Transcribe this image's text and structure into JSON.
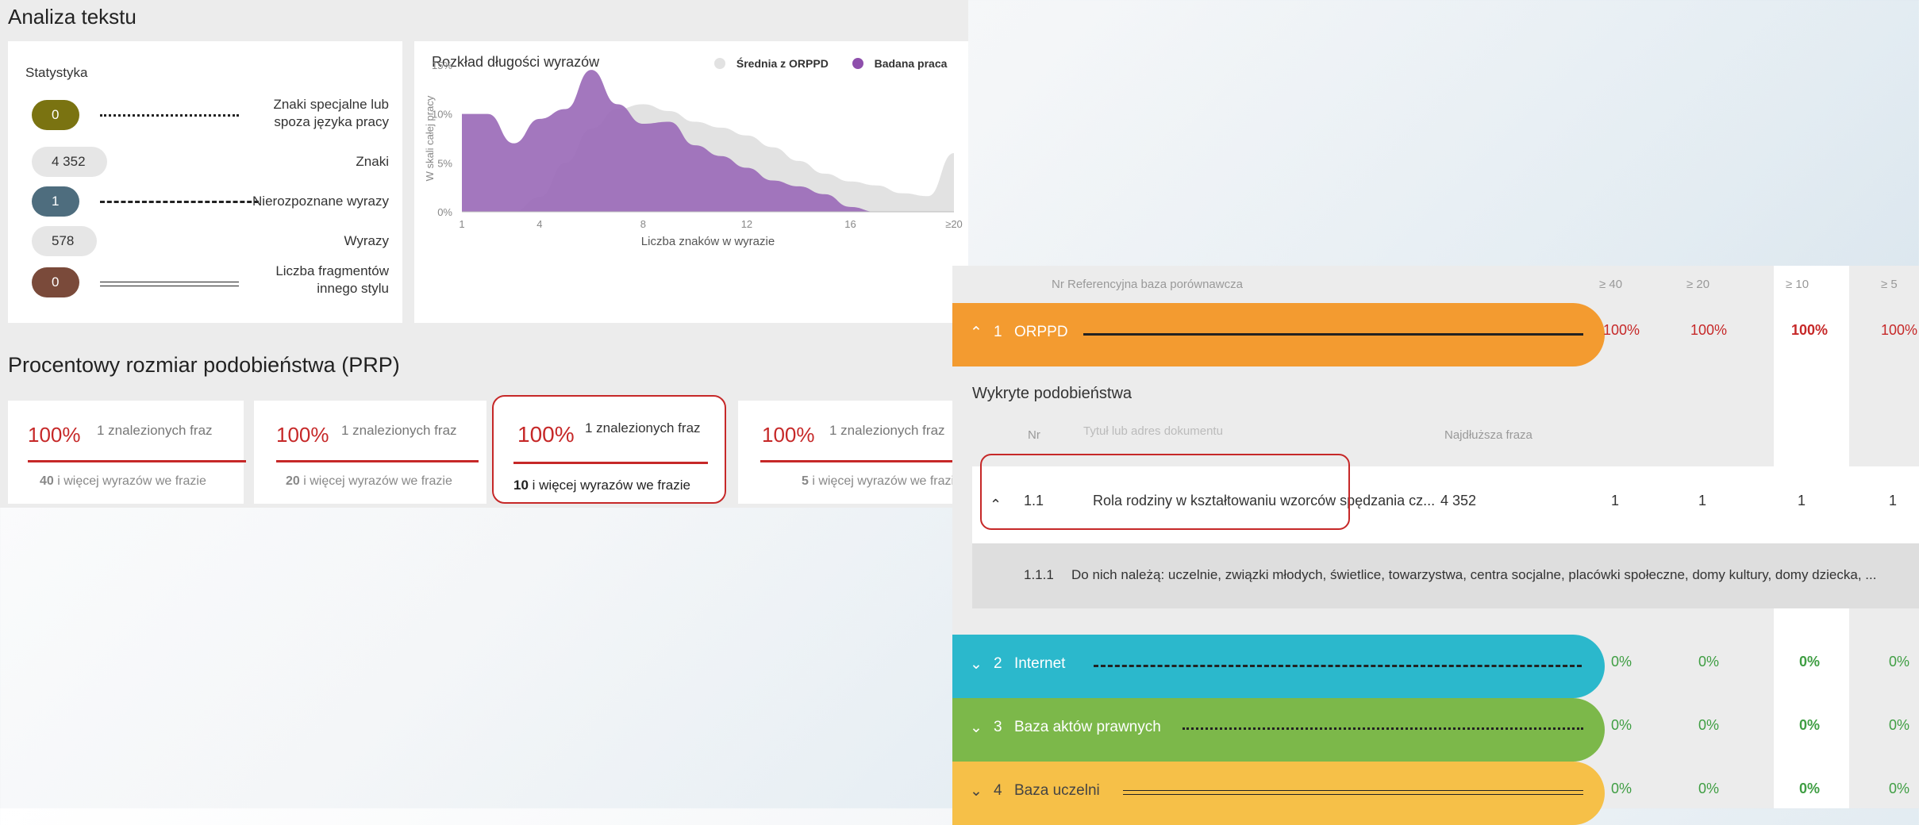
{
  "left": {
    "title": "Analiza tekstu",
    "stats": {
      "heading": "Statystyka",
      "rows": [
        {
          "value": "0",
          "label_lines": [
            "Znaki specjalne lub",
            "spoza języka pracy"
          ],
          "color": "#7a7311"
        },
        {
          "value": "4 352",
          "label_lines": [
            "Znaki"
          ],
          "color": "#e6e6e6"
        },
        {
          "value": "1",
          "label_lines": [
            "Nierozpoznane wyrazy"
          ],
          "color": "#4e6d7e"
        },
        {
          "value": "578",
          "label_lines": [
            "Wyrazy"
          ],
          "color": "#e6e6e6"
        },
        {
          "value": "0",
          "label_lines": [
            "Liczba fragmentów",
            "innego stylu"
          ],
          "color": "#7a4a3a"
        }
      ]
    },
    "chart": {
      "title": "Rozkład długości wyrazów",
      "legend_avg": "Średnia z ORPPD",
      "legend_work": "Badana praca",
      "ylabel": "W skali całej pracy",
      "xlabel": "Liczba znaków w wyrazie",
      "yticks": [
        "15%",
        "10%",
        "5%",
        "0%"
      ],
      "xticks": [
        "1",
        "4",
        "8",
        "12",
        "16",
        "≥20"
      ]
    },
    "prp": {
      "heading": "Procentowy rozmiar podobieństwa (PRP)",
      "cards": [
        {
          "pct": "100%",
          "found": "1 znalezionych fraz",
          "count": "40",
          "note": "i więcej wyrazów we frazie"
        },
        {
          "pct": "100%",
          "found": "1 znalezionych fraz",
          "count": "20",
          "note": "i więcej wyrazów we frazie"
        },
        {
          "pct": "100%",
          "found": "1 znalezionych fraz",
          "count": "10",
          "note": "i więcej wyrazów we frazie"
        },
        {
          "pct": "100%",
          "found": "1 znalezionych fraz",
          "count": "5",
          "note": "i więcej wyrazów we frazie"
        }
      ]
    }
  },
  "right": {
    "header": {
      "nr_base": "Nr Referencyjna baza porównawcza",
      "c40": "≥ 40",
      "c20": "≥ 20",
      "c10": "≥ 10",
      "c5": "≥ 5"
    },
    "refs": [
      {
        "num": "1",
        "name": "ORPPD",
        "color": "#f39b30",
        "pcts": [
          "100%",
          "100%",
          "100%",
          "100%"
        ],
        "pct_color": "#c62828"
      },
      {
        "num": "2",
        "name": "Internet",
        "color": "#2bb8cc",
        "pcts": [
          "0%",
          "0%",
          "0%",
          "0%"
        ],
        "pct_color": "#3f9e43"
      },
      {
        "num": "3",
        "name": "Baza aktów prawnych",
        "color": "#7cb84a",
        "pcts": [
          "0%",
          "0%",
          "0%",
          "0%"
        ],
        "pct_color": "#3f9e43"
      },
      {
        "num": "4",
        "name": "Baza uczelni",
        "color": "#f6c048",
        "pcts": [
          "0%",
          "0%",
          "0%",
          "0%"
        ],
        "pct_color": "#3f9e43"
      }
    ],
    "detected": {
      "heading": "Wykryte podobieństwa",
      "col_nr": "Nr",
      "col_title": "Tytuł lub adres dokumentu",
      "col_longest": "Najdłuższa fraza",
      "row": {
        "nr": "1.1",
        "title": "Rola rodziny w kształtowaniu wzorców spędzania cz...",
        "longest": "4 352",
        "counts": [
          "1",
          "1",
          "1",
          "1"
        ]
      },
      "subrow": {
        "nr": "1.1.1",
        "text": "Do nich należą: uczelnie, związki młodych, świetlice, towarzystwa, centra socjalne, placówki społeczne, domy kultury, domy dziecka, ..."
      }
    }
  },
  "chart_data": {
    "type": "area",
    "title": "Rozkład długości wyrazów",
    "xlabel": "Liczba znaków w wyrazie",
    "ylabel": "W skali całej pracy",
    "x": [
      1,
      2,
      3,
      4,
      5,
      6,
      7,
      8,
      9,
      10,
      11,
      12,
      13,
      14,
      15,
      16,
      17,
      18,
      19,
      20
    ],
    "xlim": [
      1,
      20
    ],
    "ylim": [
      0,
      15
    ],
    "series": [
      {
        "name": "Średnia z ORPPD",
        "color": "#e2e2e2",
        "values": [
          0,
          0,
          0,
          1.5,
          5,
          8.5,
          10.5,
          11,
          10.3,
          9.2,
          8.6,
          7.8,
          6.6,
          5.2,
          3.9,
          3.1,
          2.7,
          1.9,
          1.6,
          6
        ]
      },
      {
        "name": "Badana praca",
        "color": "#9b6bb8",
        "values": [
          10,
          10,
          7,
          9.5,
          10.5,
          14.5,
          11,
          9,
          9.2,
          6.8,
          5.7,
          4.5,
          3.2,
          2.6,
          1.8,
          0.5,
          0,
          0,
          0,
          0
        ]
      }
    ]
  }
}
